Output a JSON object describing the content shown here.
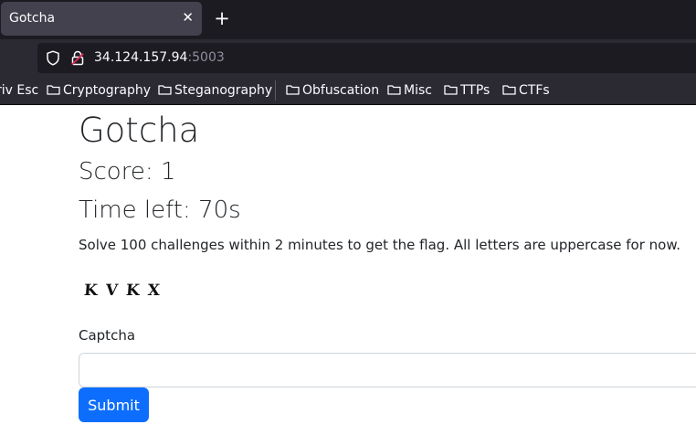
{
  "browser": {
    "tab": {
      "title": "Gotcha",
      "close_glyph": "✕"
    },
    "new_tab_glyph": "+",
    "address": {
      "host": "34.124.157.94",
      "port": ":5003"
    },
    "bookmarks": [
      {
        "label": "riv Esc",
        "icon": "none"
      },
      {
        "label": "Cryptography",
        "icon": "folder-icon"
      },
      {
        "label": "Steganography",
        "icon": "folder-icon"
      },
      {
        "label": "Obfuscation",
        "icon": "folder-icon"
      },
      {
        "label": "Misc",
        "icon": "folder-icon"
      },
      {
        "label": "TTPs",
        "icon": "folder-icon"
      },
      {
        "label": "CTFs",
        "icon": "folder-icon"
      }
    ],
    "colors": {
      "tab_strip": "#1c1b22",
      "toolbar": "#2b2a33",
      "active_tab": "#42414d",
      "lock_warning": "#e22850"
    }
  },
  "page": {
    "title": "Gotcha",
    "score": "Score: 1",
    "time_left": "Time left: 70s",
    "instructions": "Solve 100 challenges within 2 minutes to get the flag. All letters are uppercase for now.",
    "captcha_text": "KVKX",
    "captcha_label": "Captcha",
    "captcha_input_value": "",
    "submit_label": "Submit",
    "colors": {
      "primary": "#0d6efd",
      "text": "#212529"
    }
  }
}
